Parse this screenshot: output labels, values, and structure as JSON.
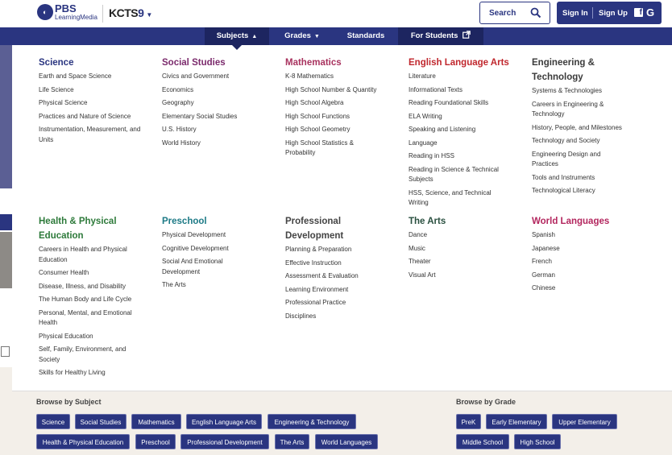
{
  "header": {
    "logo_pbs": "PBS",
    "logo_pbs_sub": "LearningMedia",
    "logo_station": "KCTS",
    "logo_station_num": "9",
    "search_label": "Search",
    "sign_in": "Sign In",
    "sign_up": "Sign Up",
    "facebook": "f",
    "google": "G"
  },
  "nav": {
    "subjects": "Subjects",
    "grades": "Grades",
    "standards": "Standards",
    "for_students": "For Students"
  },
  "menu": {
    "science": {
      "title": "Science",
      "items": [
        "Earth and Space Science",
        "Life Science",
        "Physical Science",
        "Practices and Nature of Science",
        "Instrumentation, Measurement, and Units"
      ]
    },
    "social_studies": {
      "title": "Social Studies",
      "items": [
        "Civics and Government",
        "Economics",
        "Geography",
        "Elementary Social Studies",
        "U.S. History",
        "World History"
      ]
    },
    "mathematics": {
      "title": "Mathematics",
      "items": [
        "K-8 Mathematics",
        "High School Number & Quantity",
        "High School Algebra",
        "High School Functions",
        "High School Geometry",
        "High School Statistics & Probability"
      ]
    },
    "ela": {
      "title": "English Language Arts",
      "items": [
        "Literature",
        "Informational Texts",
        "Reading Foundational Skills",
        "ELA Writing",
        "Speaking and Listening",
        "Language",
        "Reading in HSS",
        "Reading in Science & Technical Subjects",
        "HSS, Science, and Technical Writing"
      ]
    },
    "engineering": {
      "title": "Engineering & Technology",
      "items": [
        "Systems & Technologies",
        "Careers in Engineering & Technology",
        "History, People, and Milestones",
        "Technology and Society",
        "Engineering Design and Practices",
        "Tools and Instruments",
        "Technological Literacy"
      ]
    },
    "health": {
      "title": "Health & Physical Education",
      "items": [
        "Careers in Health and Physical Education",
        "Consumer Health",
        "Disease, Illness, and Disability",
        "The Human Body and Life Cycle",
        "Personal, Mental, and Emotional Health",
        "Physical Education",
        "Self, Family, Environment, and Society",
        "Skills for Healthy Living"
      ]
    },
    "preschool": {
      "title": "Preschool",
      "items": [
        "Physical Development",
        "Cognitive Development",
        "Social And Emotional Development",
        "The Arts"
      ]
    },
    "professional": {
      "title": "Professional Development",
      "items": [
        "Planning & Preparation",
        "Effective Instruction",
        "Assessment & Evaluation",
        "Learning Environment",
        "Professional Practice",
        "Disciplines"
      ]
    },
    "arts": {
      "title": "The Arts",
      "items": [
        "Dance",
        "Music",
        "Theater",
        "Visual Art"
      ]
    },
    "languages": {
      "title": "World Languages",
      "items": [
        "Spanish",
        "Japanese",
        "French",
        "German",
        "Chinese"
      ]
    }
  },
  "browse": {
    "subject_title": "Browse by Subject",
    "grade_title": "Browse by Grade",
    "subjects": [
      "Science",
      "Social Studies",
      "Mathematics",
      "English Language Arts",
      "Engineering & Technology",
      "Health & Physical Education",
      "Preschool",
      "Professional Development",
      "The Arts",
      "World Languages"
    ],
    "grades": [
      "PreK",
      "Early Elementary",
      "Upper Elementary",
      "Middle School",
      "High School"
    ]
  },
  "colors": {
    "brand_navy": "#2a3580",
    "nav_active": "#1d2560"
  }
}
